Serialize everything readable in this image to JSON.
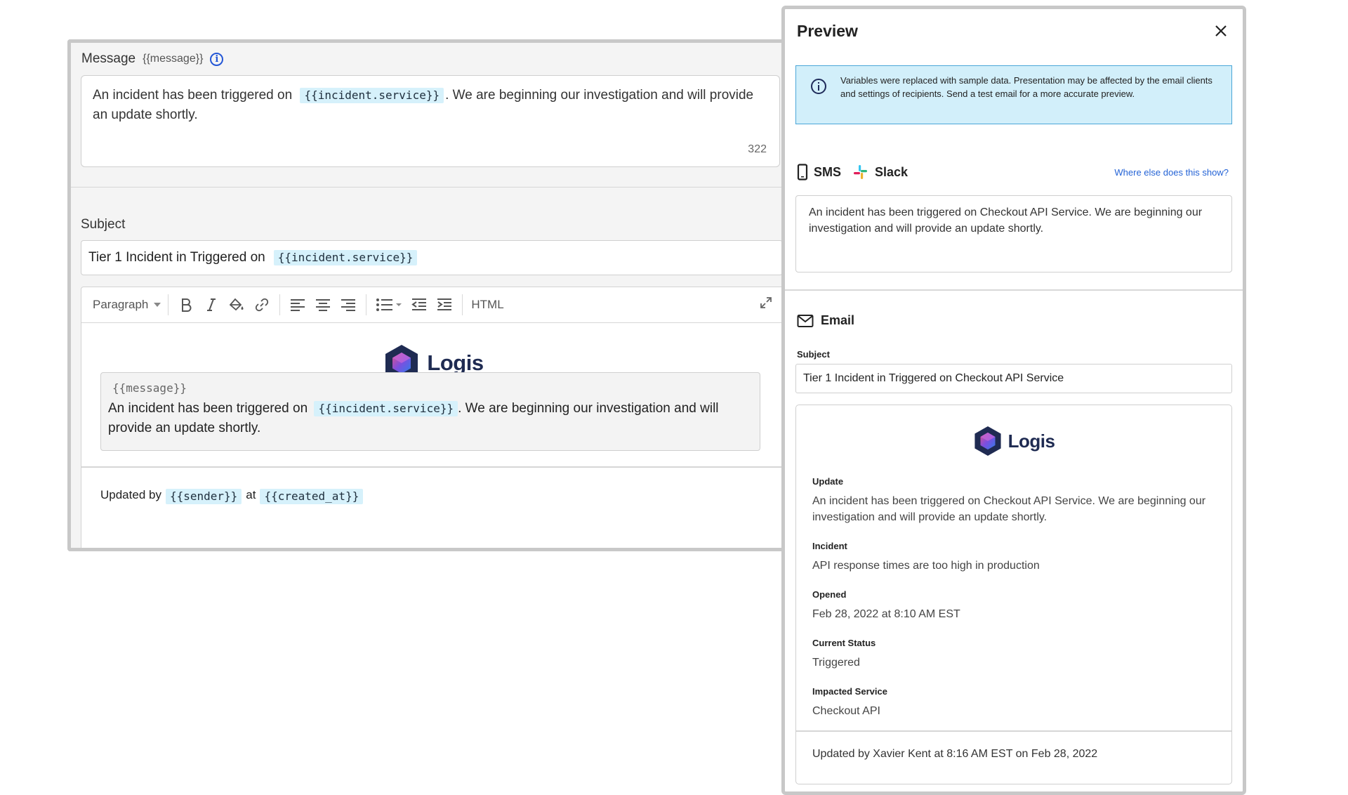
{
  "editor": {
    "message_label": "Message",
    "message_var": "{{message}}",
    "message_text_before": "An incident has been triggered on",
    "message_chip": "{{incident.service}}",
    "message_text_after": ". We are beginning our investigation and will provide an update shortly.",
    "char_count": "322",
    "subject_label": "Subject",
    "subject_text": "Tier 1 Incident in Triggered on",
    "subject_chip": "{{incident.service}}",
    "toolbar": {
      "paragraph": "Paragraph",
      "html": "HTML"
    },
    "logo_text": "Logis",
    "block_var": "{{message}}",
    "block_text_before": "An incident has been triggered on",
    "block_chip": "{{incident.service}}",
    "block_text_after": ". We are beginning our investigation and will provide an update shortly.",
    "footer_updated_by": "Updated by",
    "footer_sender": "{{sender}}",
    "footer_at": "at",
    "footer_created": "{{created_at}}"
  },
  "preview": {
    "title": "Preview",
    "notice": "Variables were replaced with sample data. Presentation may be affected by the email clients and settings of recipients. Send a test email for a more accurate preview.",
    "channel_sms": "SMS",
    "channel_slack": "Slack",
    "where_link": "Where else does this show?",
    "sms_text": "An incident has been triggered on Checkout API Service. We are beginning our investigation and will provide an update shortly.",
    "email_label": "Email",
    "subject_label": "Subject",
    "subject_value": "Tier 1 Incident in Triggered on Checkout API Service",
    "logo_text": "Logis",
    "sections": [
      {
        "label": "Update",
        "value": "An incident has been triggered on Checkout API Service. We are beginning our investigation and will provide an update shortly."
      },
      {
        "label": "Incident",
        "value": "API response times are too high in production"
      },
      {
        "label": "Opened",
        "value": "Feb 28, 2022 at 8:10 AM EST"
      },
      {
        "label": "Current Status",
        "value": "Triggered"
      },
      {
        "label": "Impacted Service",
        "value": "Checkout API"
      }
    ],
    "footer": "Updated by Xavier Kent at 8:16 AM EST on Feb 28, 2022"
  },
  "colors": {
    "chip_bg": "#d6f1fb",
    "notice_bg": "#d2effa",
    "link": "#2463d6",
    "logo_text": "#1f2b52"
  }
}
